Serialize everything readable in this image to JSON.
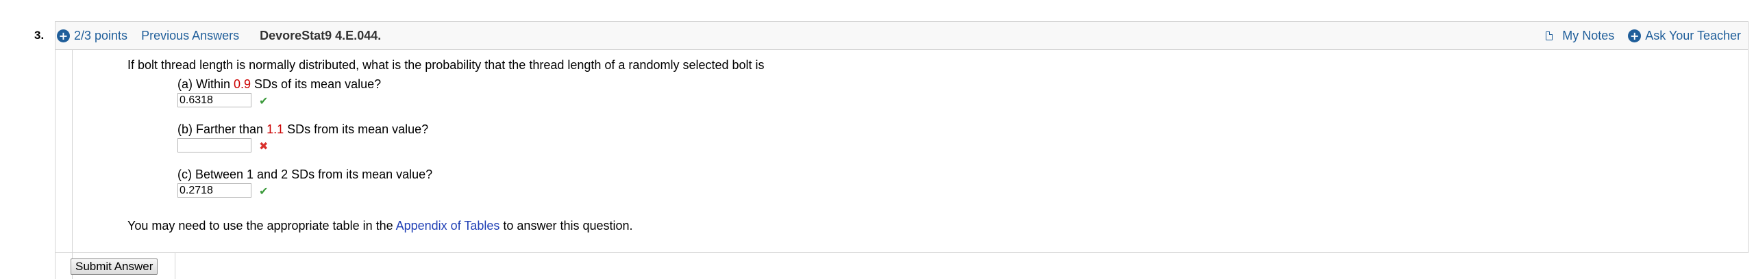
{
  "question": {
    "number": "3.",
    "points": "2/3 points",
    "previous_answers": "Previous Answers",
    "source": "DevoreStat9 4.E.044."
  },
  "header_right": {
    "my_notes": "My Notes",
    "ask_teacher": "Ask Your Teacher"
  },
  "prompt": "If bolt thread length is normally distributed, what is the probability that the thread length of a randomly selected bolt is",
  "parts": {
    "a": {
      "pre": "(a) Within ",
      "value": "0.9",
      "post": " SDs of its mean value?",
      "answer": "0.6318",
      "status": "correct"
    },
    "b": {
      "pre": "(b) Farther than ",
      "value": "1.1",
      "post": " SDs from its mean value?",
      "answer": "",
      "status": "incorrect"
    },
    "c": {
      "text": "(c) Between 1 and 2 SDs from its mean value?",
      "answer": "0.2718",
      "status": "correct"
    }
  },
  "footer": {
    "pre": "You may need to use the appropriate table in the ",
    "link": "Appendix of Tables",
    "post": " to answer this question."
  },
  "submit_label": "Submit Answer",
  "icons": {
    "check": "check-icon",
    "cross": "cross-icon",
    "plus": "plus-circle-icon",
    "note": "note-icon"
  },
  "colors": {
    "link": "#1f5e9a",
    "highlight": "#cc0000",
    "correct": "#3d9b3d",
    "incorrect": "#d9302b",
    "appendix_link": "#1f3fb5"
  }
}
